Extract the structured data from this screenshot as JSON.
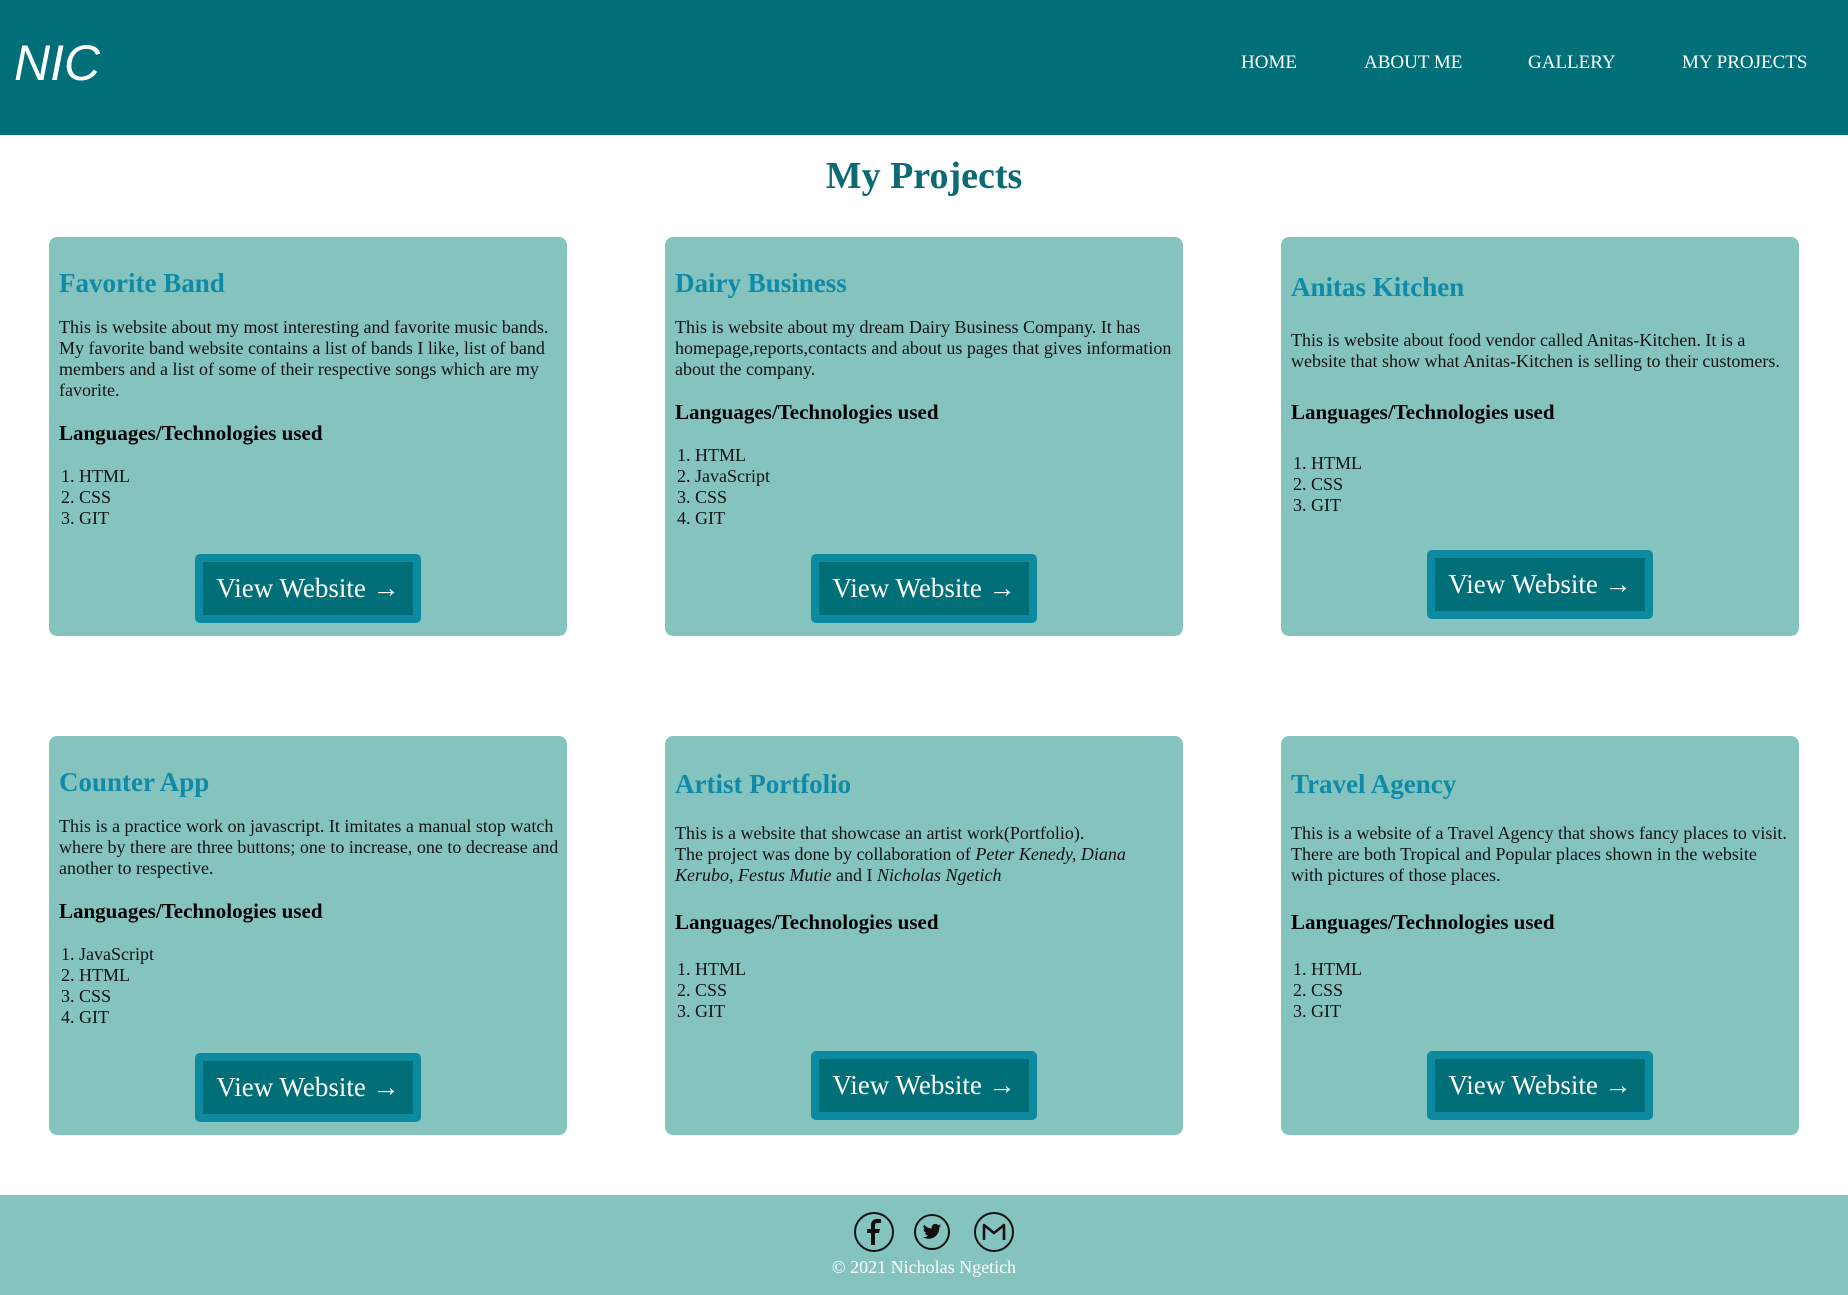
{
  "header": {
    "logo": "NIC",
    "nav": [
      "HOME",
      "ABOUT ME",
      "GALLERY",
      "MY PROJECTS"
    ]
  },
  "page_title": "My Projects",
  "projects": [
    {
      "title": "Favorite Band",
      "description": "This is website about my most interesting and favorite music bands. My favorite band website contains a list of bands I like, list of band members and a list of some of their respective songs which are my favorite.",
      "subheading": "Languages/Technologies used",
      "tech": [
        "1. HTML",
        "2. CSS",
        "3. GIT"
      ],
      "button": "View Website →"
    },
    {
      "title": "Dairy Business",
      "description": "This is website about my dream Dairy Business Company. It has homepage,reports,contacts and about us pages that gives information about the company.",
      "subheading": "Languages/Technologies used",
      "tech": [
        "1. HTML",
        "2. JavaScript",
        "3. CSS",
        "4. GIT"
      ],
      "button": "View Website →"
    },
    {
      "title": "Anitas Kitchen",
      "description": "This is website about food vendor called Anitas-Kitchen. It is a website that show what Anitas-Kitchen is selling to their customers.",
      "subheading": "Languages/Technologies used",
      "tech": [
        "1. HTML",
        "2. CSS",
        "3. GIT"
      ],
      "button": "View Website →"
    },
    {
      "title": "Counter App",
      "description": "This is a practice work on javascript. It imitates a manual stop watch where by there are three buttons; one to increase, one to decrease and another to respective.",
      "subheading": "Languages/Technologies used",
      "tech": [
        "1. JavaScript",
        "2. HTML",
        "3. CSS",
        "4. GIT"
      ],
      "button": "View Website →"
    },
    {
      "title": "Artist Portfolio",
      "description_line1": "This is a website that showcase an artist work(Portfolio).",
      "description_line2_prefix": "The project was done by collaboration of ",
      "collaborators": "Peter Kenedy, Diana Kerubo, Festus Mutie",
      "description_line2_mid": " and I ",
      "author": "Nicholas Ngetich",
      "subheading": "Languages/Technologies used",
      "tech": [
        "1. HTML",
        "2. CSS",
        "3. GIT"
      ],
      "button": "View Website →"
    },
    {
      "title": "Travel Agency",
      "description": "This is a website of a Travel Agency that shows fancy places to visit. There are both Tropical and Popular places shown in the website with pictures of those places.",
      "subheading": "Languages/Technologies used",
      "tech": [
        "1. HTML",
        "2. CSS",
        "3. GIT"
      ],
      "button": "View Website →"
    }
  ],
  "footer": {
    "social_icons": [
      "facebook-icon",
      "twitter-icon",
      "gmail-icon"
    ],
    "copyright": "© 2021 Nicholas Ngetich"
  },
  "colors": {
    "header_bg": "#006f78",
    "card_bg": "#85c4be",
    "title_color": "#0b6a74",
    "card_title_color": "#0f8aa8",
    "button_outer": "#0e8aa0",
    "button_inner": "#006f78"
  }
}
